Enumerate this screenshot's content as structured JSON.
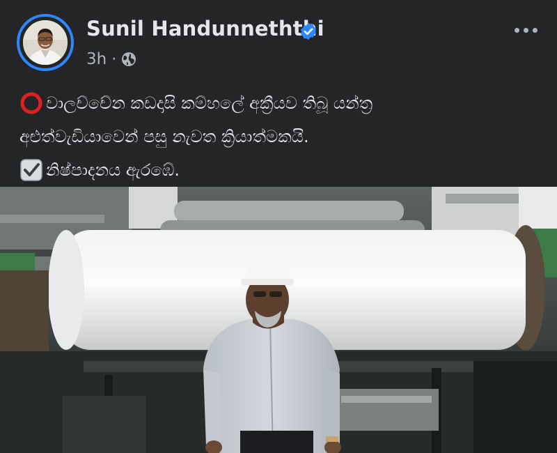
{
  "post": {
    "author": "Sunil Handunneththi",
    "verified": true,
    "timestamp": "3h",
    "separator": "·",
    "audience_icon": "globe-icon",
    "more_icon": "more-horizontal-icon",
    "text_lines": [
      {
        "emoji": "hollow-red-circle",
        "text": "වාලච්චේන කඩදාසි කම්හලේ අක්‍රීයව තිබූ යන්ත්‍ර"
      },
      {
        "emoji": "",
        "text": "අළුත්වැඩියාවෙන් පසු නැවත ක්‍රියාත්මකයි."
      },
      {
        "emoji": "check-box",
        "text": "නිෂ්පාදනය ඇරඹේ."
      }
    ],
    "media": {
      "type": "video-frame",
      "subject": "man in hard hat in front of paper mill roller"
    }
  },
  "colors": {
    "background": "#242526",
    "primary_text": "#e4e6eb",
    "secondary_text": "#b0b3b8",
    "verified_blue": "#2d88ff",
    "story_ring": "#2d88ff"
  }
}
